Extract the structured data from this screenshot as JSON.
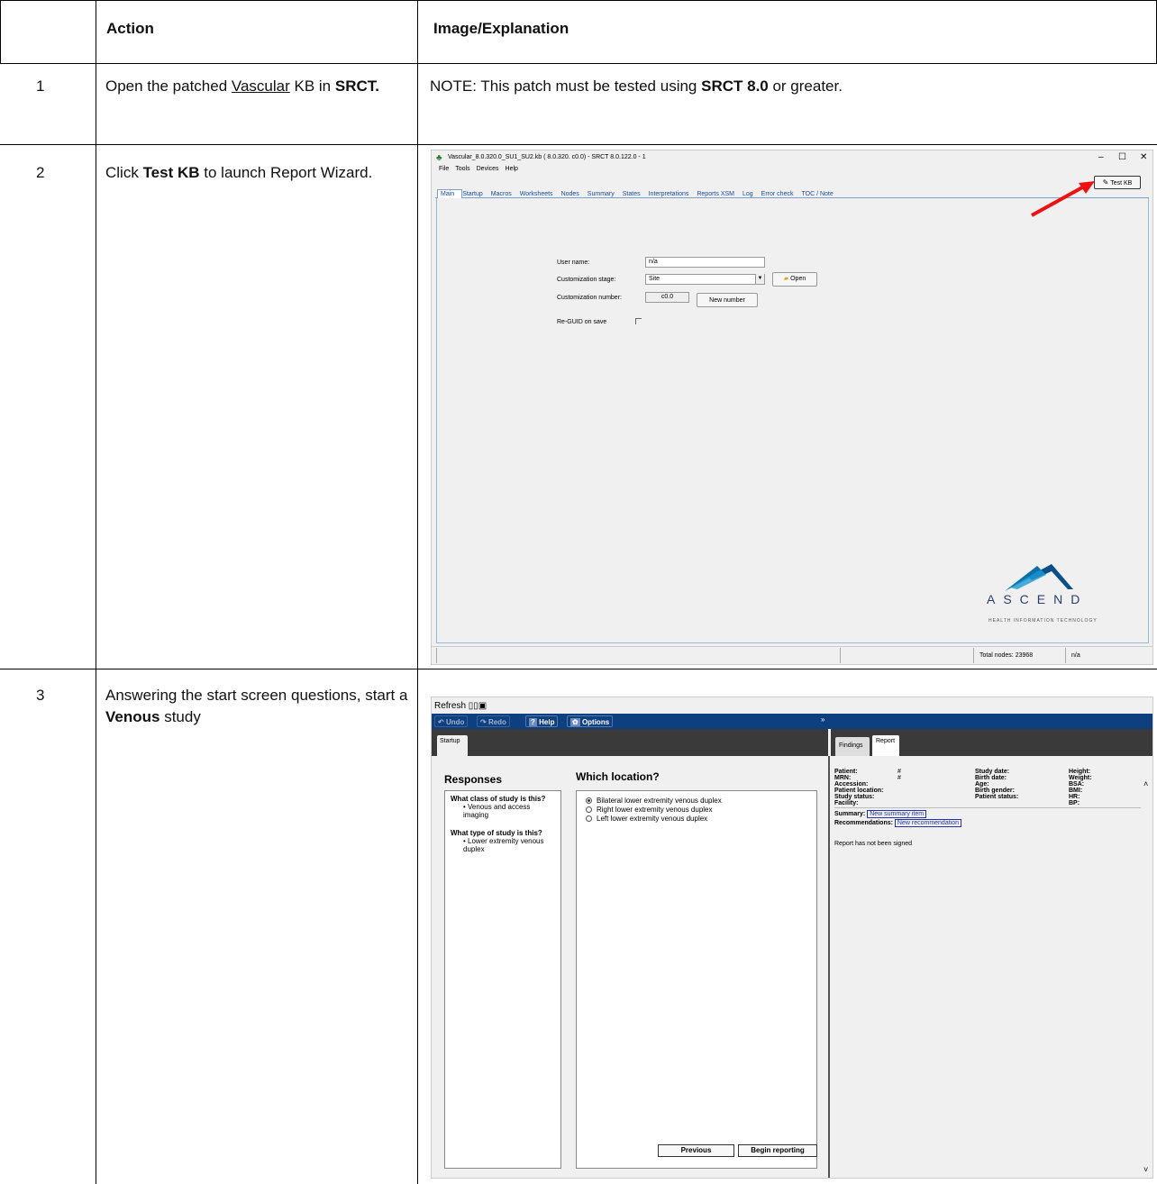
{
  "table": {
    "headers": [
      "Action",
      "Image/Explanation"
    ],
    "rows": [
      {
        "num": "1",
        "action_pre": "Open the patched ",
        "action_link": "Vascular",
        "action_mid": " KB in ",
        "action_bold": "SRCT.",
        "exp_pre": "NOTE: This patch must be tested using ",
        "exp_bold": "SRCT 8.0",
        "exp_post": " or greater."
      },
      {
        "num": "2",
        "action_pre": "Click ",
        "action_bold": "Test KB",
        "action_post": " to launch Report Wizard."
      },
      {
        "num": "3",
        "action_pre": "Answering the start screen questions, start a ",
        "action_bold": "Venous",
        "action_post": " study"
      }
    ]
  },
  "srct": {
    "title": "Vascular_8.0.320.0_SU1_SU2.kb ( 8.0.320. c0.0) - SRCT 8.0.122.0 - 1",
    "menu": [
      "File",
      "Tools",
      "Devices",
      "Help"
    ],
    "tabs": [
      "Main",
      "Startup",
      "Macros",
      "Worksheets",
      "Nodes",
      "Summary",
      "States",
      "Interpretations",
      "Reports XSM",
      "Log",
      "Error check",
      "TOC / Note"
    ],
    "test_kb": "Test KB",
    "user_name_label": "User name:",
    "user_name_value": "n/a",
    "stage_label": "Customization stage:",
    "stage_value": "Site",
    "open_button": "Open",
    "number_label": "Customization number:",
    "number_value": "c0.0",
    "new_number_button": "New number",
    "reguid_label": "Re-GUID on save",
    "logo_text": "ASCEND",
    "logo_sub": "HEALTH INFORMATION TECHNOLOGY",
    "status_total": "Total nodes:  23968",
    "status_na": "n/a",
    "window_controls": [
      "–",
      "☐",
      "✕"
    ]
  },
  "wizard": {
    "refresh": "Refresh",
    "toolbar": [
      "Undo",
      "Redo",
      "Help",
      "Options"
    ],
    "left_tab": "Startup",
    "right_tabs": [
      "Findings",
      "Report"
    ],
    "responses_title": "Responses",
    "q1": "What class of study is this?",
    "a1": "• Venous and access imaging",
    "q2": "What type of study is this?",
    "a2": "• Lower extremity venous duplex",
    "location_title": "Which location?",
    "options": [
      "Bilateral lower extremity venous duplex",
      "Right lower extremity venous duplex",
      "Left lower extremity venous duplex"
    ],
    "selected_option": 0,
    "previous": "Previous",
    "begin": "Begin reporting",
    "col1": [
      "Patient:",
      "MRN:",
      "Accession:",
      "Patient location:",
      "Study status:",
      "Facility:"
    ],
    "col1v": [
      "",
      "#",
      "#",
      "",
      "",
      ""
    ],
    "col2": [
      "Study date:",
      "Birth date:",
      "Age:",
      "Birth gender:",
      "Patient status:"
    ],
    "col3": [
      "Height:",
      "Weight:",
      "BSA:",
      "BMI:",
      "HR:",
      "BP:"
    ],
    "summary_label": "Summary:",
    "summary_link": "New summary item",
    "recommend_label": "Recommendations:",
    "recommend_link": "New recommendation",
    "not_signed": "Report has not been signed"
  }
}
